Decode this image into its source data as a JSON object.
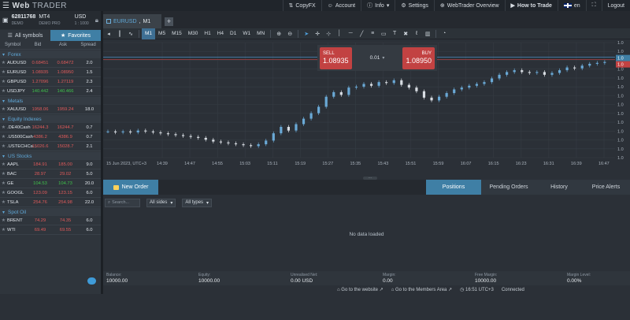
{
  "app": {
    "logo_bold": "Web",
    "logo_light": "TRADER"
  },
  "topnav": {
    "copyfx": "CopyFX",
    "account": "Account",
    "info": "Info",
    "settings": "Settings",
    "overview": "WebTrader Overview",
    "howto": "How to Trade",
    "lang": "en",
    "logout": "Logout"
  },
  "account_panel": {
    "number": "62811768",
    "type": "DEMO",
    "platform": "MT4",
    "server": "DEMO PRO",
    "currency": "USD",
    "leverage": "1 : 1000"
  },
  "sidebar": {
    "tab_all": "All symbols",
    "tab_fav": "Favorites",
    "headers": [
      "Symbol",
      "Bid",
      "Ask",
      "Spread"
    ],
    "groups": [
      {
        "name": "Forex",
        "rows": [
          {
            "sym": "AUDUSD",
            "bid": "0.68451",
            "ask": "0.68472",
            "spread": "2.0",
            "color": "red"
          },
          {
            "sym": "EURUSD",
            "bid": "1.08935",
            "ask": "1.08950",
            "spread": "1.5",
            "color": "red"
          },
          {
            "sym": "GBPUSD",
            "bid": "1.27096",
            "ask": "1.27119",
            "spread": "2.3",
            "color": "red"
          },
          {
            "sym": "USDJPY",
            "bid": "140.442",
            "ask": "140.466",
            "spread": "2.4",
            "color": "green"
          }
        ]
      },
      {
        "name": "Metals",
        "rows": [
          {
            "sym": "XAUUSD",
            "bid": "1958.06",
            "ask": "1959.24",
            "spread": "18.0",
            "color": "red"
          }
        ]
      },
      {
        "name": "Equity Indexes",
        "rows": [
          {
            "sym": ".DE40Cash",
            "bid": "16244.3",
            "ask": "16244.7",
            "spread": "0.7",
            "color": "red"
          },
          {
            "sym": ".US500Cash",
            "bid": "4386.2",
            "ask": "4386.9",
            "spread": "0.7",
            "color": "red"
          },
          {
            "sym": ".USTECHCa...",
            "bid": "15026.6",
            "ask": "15028.7",
            "spread": "2.1",
            "color": "red"
          }
        ]
      },
      {
        "name": "US Stocks",
        "rows": [
          {
            "sym": "AAPL",
            "bid": "184.91",
            "ask": "185.00",
            "spread": "9.0",
            "color": "red"
          },
          {
            "sym": "BAC",
            "bid": "28.97",
            "ask": "29.02",
            "spread": "5.0",
            "color": "red"
          },
          {
            "sym": "GE",
            "bid": "104.53",
            "ask": "104.73",
            "spread": "20.0",
            "color": "green"
          },
          {
            "sym": "GOOGL",
            "bid": "123.09",
            "ask": "123.15",
            "spread": "6.0",
            "color": "red"
          },
          {
            "sym": "TSLA",
            "bid": "254.76",
            "ask": "254.98",
            "spread": "22.0",
            "color": "red"
          }
        ]
      },
      {
        "name": "Spot Oil",
        "rows": [
          {
            "sym": "BRENT",
            "bid": "74.29",
            "ask": "74.35",
            "spread": "6.0",
            "color": "red"
          },
          {
            "sym": "WTI",
            "bid": "69.49",
            "ask": "69.55",
            "spread": "6.0",
            "color": "red"
          }
        ]
      }
    ]
  },
  "chart_tab": {
    "symbol": "EURUSD",
    "tf": "M1"
  },
  "toolbar": {
    "timeframes": [
      "M1",
      "M5",
      "M15",
      "M30",
      "H1",
      "H4",
      "D1",
      "W1",
      "MN"
    ],
    "active": "M1"
  },
  "trade_panel": {
    "sell_label": "SELL",
    "sell_price": "1.08935",
    "lot": "0.01",
    "buy_label": "BUY",
    "buy_price": "1.08950"
  },
  "chart_data": {
    "type": "candlestick",
    "symbol": "EURUSD",
    "timeframe": "M1",
    "x_labels": [
      "15 Jun 2023, UTC+3",
      "14:39",
      "14:47",
      "14:55",
      "15:03",
      "15:11",
      "15:19",
      "15:27",
      "15:35",
      "15:43",
      "15:51",
      "15:59",
      "16:07",
      "16:15",
      "16:23",
      "16:31",
      "16:39",
      "16:47"
    ],
    "y_labels": [
      "1.0",
      "1.0",
      "1.0",
      "1.0",
      "1.0",
      "1.0",
      "1.0",
      "1.0",
      "1.0",
      "1.0",
      "1.0",
      "1.0",
      "1.0",
      "1.0"
    ],
    "price_tags": [
      "1.0",
      "1.0"
    ],
    "closes": [
      0.2,
      0.19,
      0.2,
      0.19,
      0.21,
      0.2,
      0.19,
      0.18,
      0.17,
      0.16,
      0.15,
      0.14,
      0.13,
      0.11,
      0.09,
      0.08,
      0.07,
      0.06,
      0.05,
      0.04,
      0.06,
      0.1,
      0.18,
      0.25,
      0.21,
      0.28,
      0.34,
      0.4,
      0.47,
      0.58,
      0.63,
      0.6,
      0.68,
      0.69,
      0.72,
      0.7,
      0.74,
      0.73,
      0.76,
      0.71,
      0.68,
      0.64,
      0.57,
      0.54,
      0.58,
      0.62,
      0.66,
      0.68,
      0.7,
      0.72,
      0.74,
      0.78,
      0.82,
      0.85,
      0.87,
      0.85,
      0.84,
      0.85,
      0.82,
      0.84,
      0.87,
      0.9,
      0.89,
      0.92,
      0.94,
      0.95,
      0.96
    ]
  },
  "bottom": {
    "new_order": "New Order",
    "tabs": [
      "Positions",
      "Pending Orders",
      "History",
      "Price Alerts"
    ],
    "search_placeholder": "Search...",
    "filter_sides": "All sides",
    "filter_types": "All types",
    "nodata": "No data loaded",
    "summary": [
      {
        "label": "Balance:",
        "value": "10000.00"
      },
      {
        "label": "Equity:",
        "value": "10000.00"
      },
      {
        "label": "Unrealised Net:",
        "value": "0.00 USD"
      },
      {
        "label": "Margin:",
        "value": "0.00"
      },
      {
        "label": "Free Margin:",
        "value": "10000.00"
      },
      {
        "label": "Margin Level:",
        "value": "0.00%"
      }
    ]
  },
  "status": {
    "website": "Go to the website",
    "members": "Go to the Members Area",
    "time": "16:51 UTC+3",
    "conn": "Connected"
  },
  "colors": {
    "accent": "#3f7fa5",
    "up": "#6aa9d6",
    "down": "#d8dde3",
    "sell": "#c24242",
    "grid": "#3a4048"
  }
}
